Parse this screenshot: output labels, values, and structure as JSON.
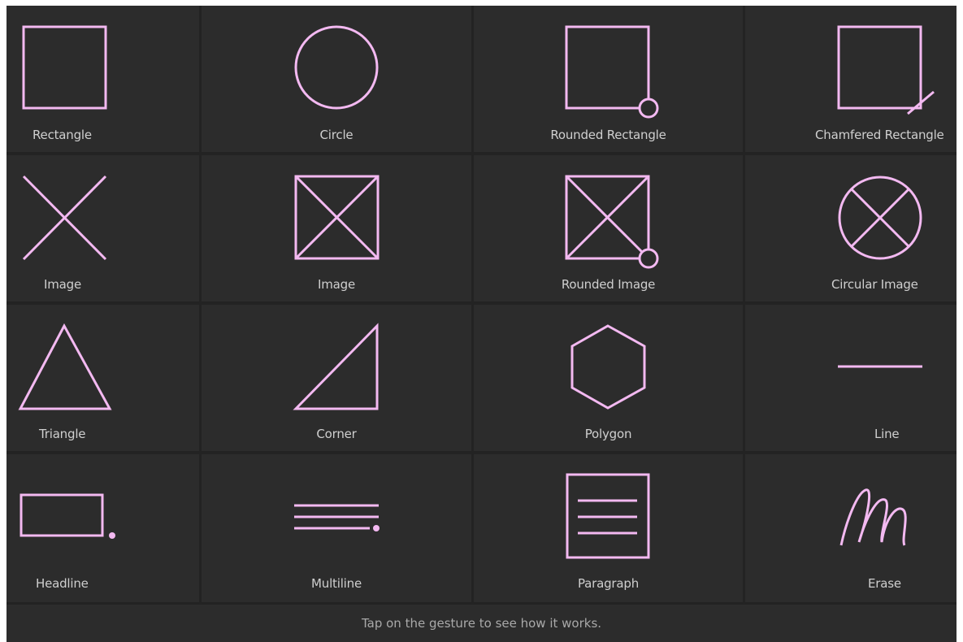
{
  "gestures": [
    {
      "label": "Rectangle",
      "icon": "rectangle-icon"
    },
    {
      "label": "Circle",
      "icon": "circle-icon"
    },
    {
      "label": "Rounded Rectangle",
      "icon": "rounded-rectangle-icon"
    },
    {
      "label": "Chamfered Rectangle",
      "icon": "chamfered-rectangle-icon"
    },
    {
      "label": "Image",
      "icon": "image-x-icon"
    },
    {
      "label": "Image",
      "icon": "image-box-icon"
    },
    {
      "label": "Rounded Image",
      "icon": "rounded-image-icon"
    },
    {
      "label": "Circular Image",
      "icon": "circular-image-icon"
    },
    {
      "label": "Triangle",
      "icon": "triangle-icon"
    },
    {
      "label": "Corner",
      "icon": "corner-icon"
    },
    {
      "label": "Polygon",
      "icon": "polygon-icon"
    },
    {
      "label": "Line",
      "icon": "line-icon"
    },
    {
      "label": "Headline",
      "icon": "headline-icon"
    },
    {
      "label": "Multiline",
      "icon": "multiline-icon"
    },
    {
      "label": "Paragraph",
      "icon": "paragraph-icon"
    },
    {
      "label": "Erase",
      "icon": "erase-icon"
    }
  ],
  "footer": {
    "hint": "Tap on the gesture to see how it works."
  },
  "colors": {
    "stroke": "#f3b9f1",
    "background": "#232323",
    "cell": "#2c2c2c",
    "label": "#cfcfcf"
  }
}
